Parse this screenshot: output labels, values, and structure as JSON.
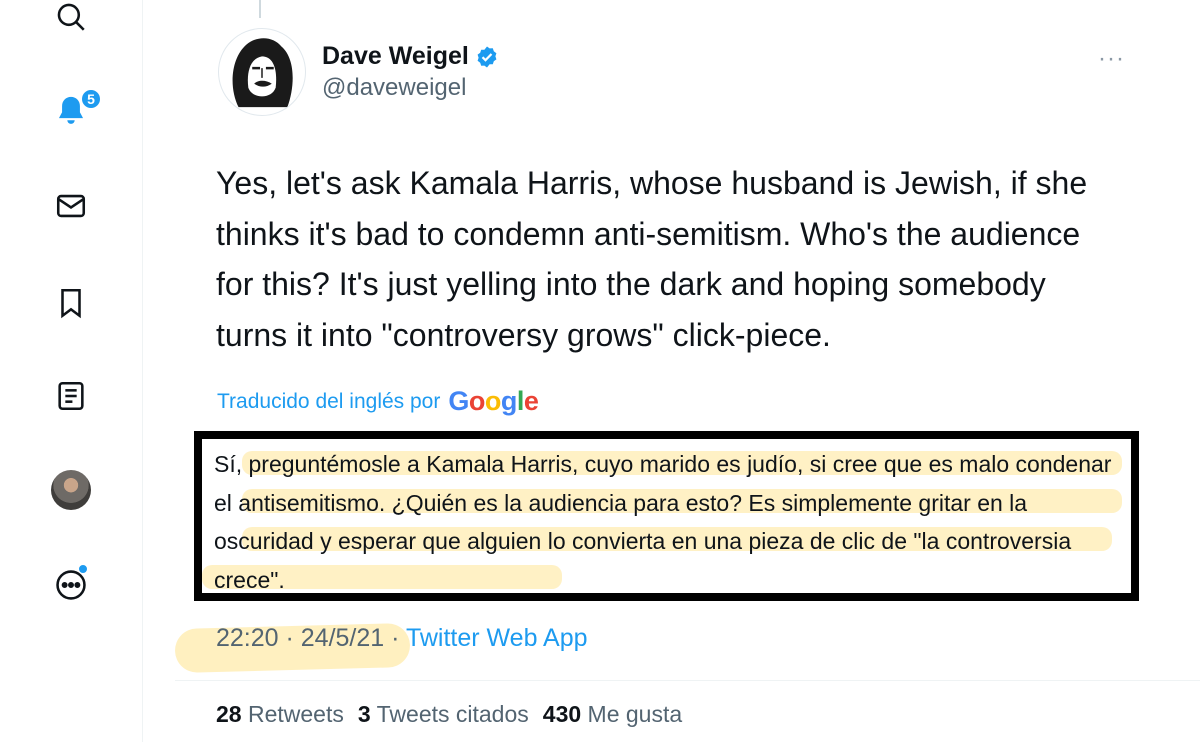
{
  "sidebar": {
    "icons": [
      "search-icon",
      "notifications-icon",
      "messages-icon",
      "bookmarks-icon",
      "lists-icon",
      "profile-avatar",
      "more-icon"
    ],
    "notifications_badge": "5"
  },
  "tweet": {
    "author_name": "Dave Weigel",
    "author_handle": "@daveweigel",
    "more_label": "···",
    "text": "Yes, let's ask Kamala Harris, whose husband is Jewish, if she thinks it's bad to condemn anti-semitism. Who's the audience for this? It's just yelling into the dark and hoping somebody turns it into \"controversy grows\" click-piece.",
    "translated_label": "Traducido del inglés por",
    "translation": "Sí, preguntémosle a Kamala Harris, cuyo marido es judío, si cree que es malo condenar el antisemitismo. ¿Quién es la audiencia para esto? Es simplemente gritar en la oscuridad y esperar que alguien lo convierta en una pieza de clic de \"la controversia crece\".",
    "timestamp": "22:20 · 24/5/21 ·",
    "source": "Twitter Web App"
  },
  "stats": {
    "retweets_count": "28",
    "retweets_label": "Retweets",
    "quotes_count": "3",
    "quotes_label": "Tweets citados",
    "likes_count": "430",
    "likes_label": "Me gusta"
  },
  "colors": {
    "accent": "#1d9bf0",
    "text": "#0f1419",
    "secondary": "#536471",
    "highlight": "#ffe696"
  }
}
